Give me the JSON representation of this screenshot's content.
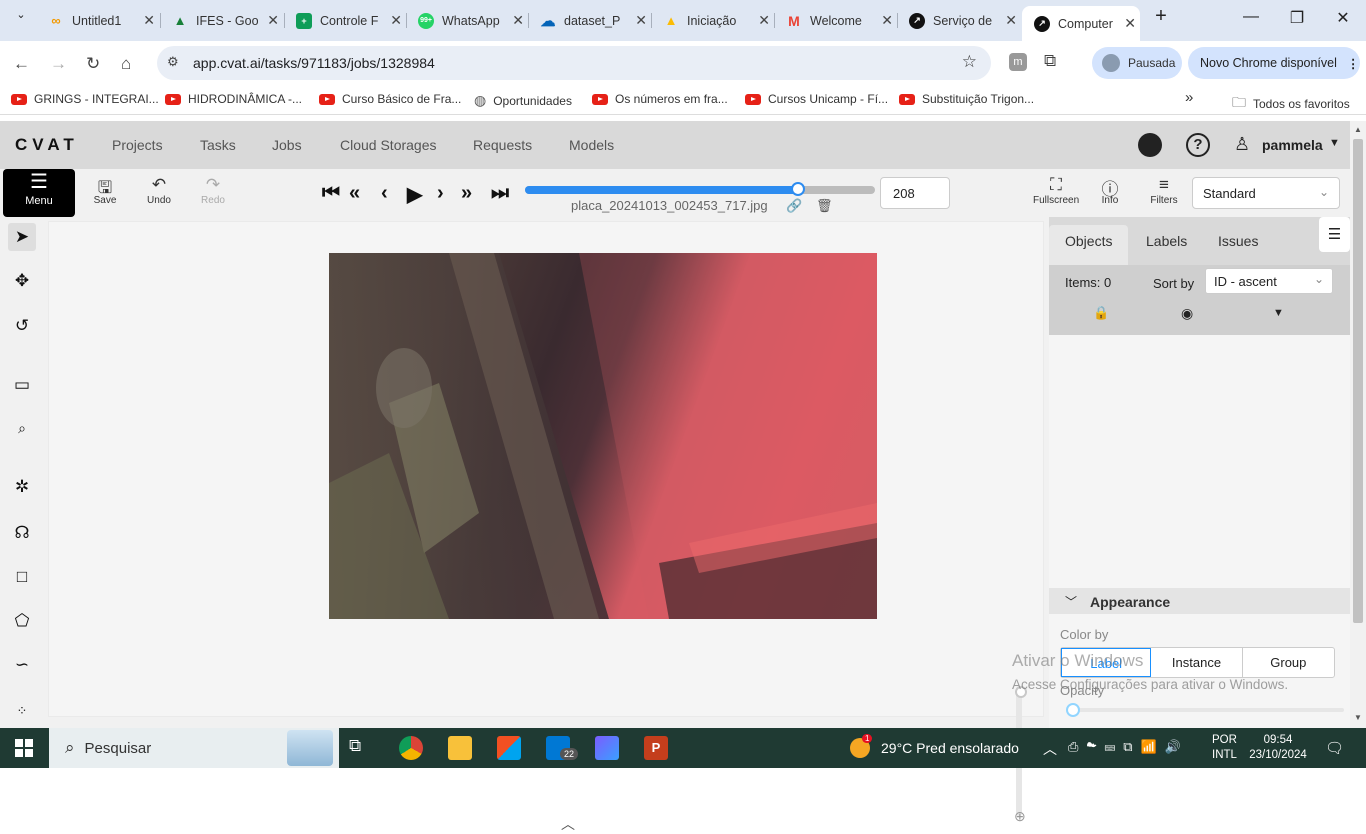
{
  "browser": {
    "tabs": [
      {
        "title": "Untitled1",
        "color": "#f29900",
        "glyph": "∞"
      },
      {
        "title": "IFES - Goo",
        "color": "#188038",
        "glyph": "▲"
      },
      {
        "title": "Controle F",
        "color": "#0f9d58",
        "glyph": "+"
      },
      {
        "title": "WhatsApp",
        "color": "#25d366",
        "glyph": "99+"
      },
      {
        "title": "dataset_P",
        "color": "#0364b8",
        "glyph": "☁"
      },
      {
        "title": "Iniciação",
        "color": "#fbbc04",
        "glyph": "▲"
      },
      {
        "title": "Welcome",
        "color": "#ea4335",
        "glyph": "M"
      },
      {
        "title": "Serviço de",
        "color": "#111111",
        "glyph": "↗"
      },
      {
        "title": "Computer",
        "color": "#111111",
        "glyph": "↗"
      }
    ],
    "url": "app.cvat.ai/tasks/971183/jobs/1328984",
    "profile_label": "Pausada",
    "update_label": "Novo Chrome disponível",
    "bookmarks": [
      "GRINGS - INTEGRAI...",
      "HIDRODINÂMICA -...",
      "Curso Básico de Fra...",
      "Oportunidades",
      "Os números em fra...",
      "Cursos Unicamp - Fí...",
      "Substituição Trigon..."
    ],
    "all_bookmarks": "Todos os favoritos"
  },
  "cvat": {
    "logo": "CVAT",
    "nav": [
      "Projects",
      "Tasks",
      "Jobs",
      "Cloud Storages",
      "Requests",
      "Models"
    ],
    "user": "pammela",
    "menu_label": "Menu",
    "save_label": "Save",
    "undo_label": "Undo",
    "redo_label": "Redo",
    "frame_name": "placa_20241013_002453_717.jpg",
    "frame_number": "208",
    "frame_progress": 0.78,
    "fullscreen_label": "Fullscreen",
    "info_label": "Info",
    "filters_label": "Filters",
    "workspace": "Standard",
    "panel": {
      "tabs": [
        "Objects",
        "Labels",
        "Issues"
      ],
      "items_label": "Items: 0",
      "sort_label": "Sort by",
      "sort_value": "ID - ascent",
      "appearance_label": "Appearance",
      "color_by_label": "Color by",
      "color_by_options": [
        "Label",
        "Instance",
        "Group"
      ],
      "opacity_label": "Opacity"
    }
  },
  "windows": {
    "watermark_title": "Ativar o Windows",
    "watermark_sub": "Acesse Configurações para ativar o Windows.",
    "search_placeholder": "Pesquisar",
    "weather": "29°C  Pred ensolarado",
    "lang1": "POR",
    "lang2": "INTL",
    "time": "09:54",
    "date": "23/10/2024",
    "mail_badge": "22",
    "weather_badge": "1"
  }
}
